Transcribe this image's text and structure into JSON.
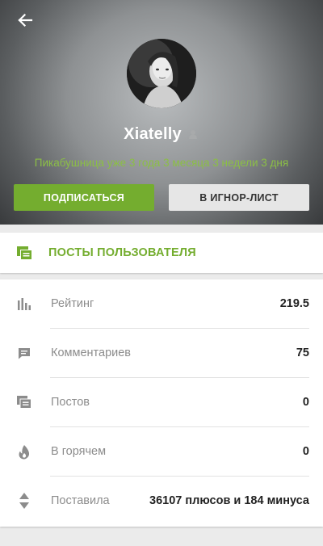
{
  "profile": {
    "username": "Xiatelly",
    "tenure": "Пикабушница уже 3 года 3 месяца 3 недели 3 дня",
    "subscribe_label": "ПОДПИСАТЬСЯ",
    "ignore_label": "В ИГНОР-ЛИСТ",
    "gender_icon": "female-gender-icon"
  },
  "posts_link": {
    "label": "ПОСТЫ ПОЛЬЗОВАТЕЛЯ",
    "icon": "posts-stack-icon"
  },
  "stats": [
    {
      "label": "Рейтинг",
      "value": "219.5",
      "icon": "rating-bars-icon"
    },
    {
      "label": "Комментариев",
      "value": "75",
      "icon": "comment-icon"
    },
    {
      "label": "Постов",
      "value": "0",
      "icon": "posts-stack-icon"
    },
    {
      "label": "В горячем",
      "value": "0",
      "icon": "fire-icon"
    },
    {
      "label": "Поставила",
      "value": "36107 плюсов и 184 минуса",
      "icon": "up-down-arrows-icon"
    }
  ],
  "colors": {
    "accent_green": "#74ad2f",
    "tenure_green": "#8bbf45",
    "icon_gray": "#8c8c8c"
  }
}
